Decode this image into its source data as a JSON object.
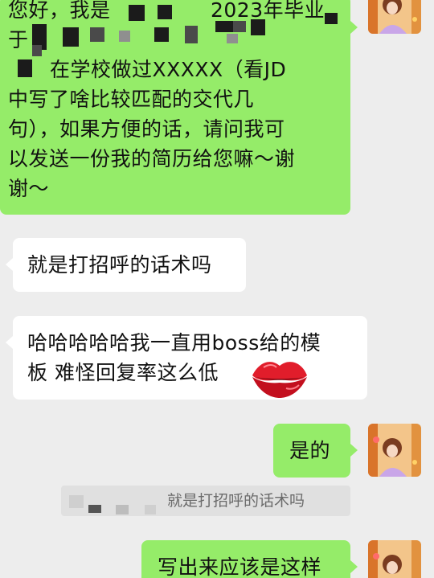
{
  "messages": [
    {
      "side": "sent",
      "lines": [
        "您好，我是",
        "2023年毕业",
        "于",
        "在学校做过XXXXX（看JD",
        "中写了啥比较匹配的交代几",
        "句），如果方便的话，请问我可",
        "以发送一份我的简历给您嘛～谢",
        "谢～"
      ]
    },
    {
      "side": "received",
      "text": "就是打招呼的话术吗"
    },
    {
      "side": "received",
      "lines": [
        "哈哈哈哈哈我一直用boss给的模",
        "板 难怪回复率这么低"
      ],
      "sticker": "red-lips-kiss"
    },
    {
      "side": "sent",
      "text": "是的"
    },
    {
      "side": "quote",
      "text": "就是打招呼的话术吗"
    },
    {
      "side": "sent",
      "text": "写出来应该是这样"
    }
  ],
  "colors": {
    "background": "#ededed",
    "sent_bubble": "#95ec69",
    "received_bubble": "#ffffff",
    "quote_bubble": "#e0e0e0"
  },
  "icons": [
    "user-avatar",
    "red-lips-sticker"
  ]
}
